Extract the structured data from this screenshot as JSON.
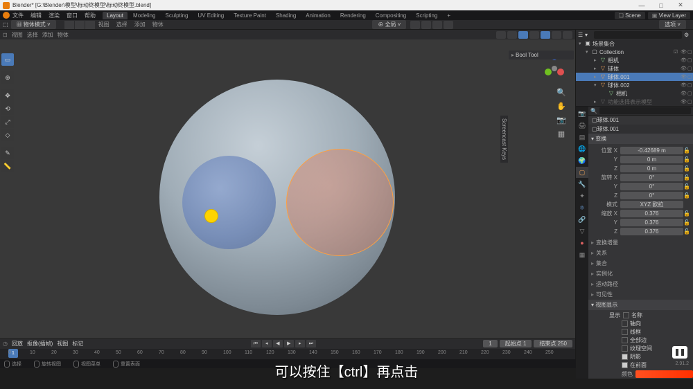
{
  "titlebar": {
    "title": "Blender* [G:\\Blender\\模型\\标动终模型\\标动终模型.blend]"
  },
  "menubar": {
    "menus": [
      "文件",
      "编辑",
      "渲染",
      "窗口",
      "帮助"
    ],
    "tabs": [
      "Layout",
      "Modeling",
      "Sculpting",
      "UV Editing",
      "Texture Paint",
      "Shading",
      "Animation",
      "Rendering",
      "Compositing",
      "Scripting"
    ],
    "active_tab": "Layout",
    "scene_label": "Scene",
    "viewlayer_label": "View Layer"
  },
  "toolbar2": {
    "mode": "物体模式",
    "submenus": [
      "选择",
      "添加",
      "物体",
      "视图"
    ],
    "global": "全局",
    "right_dropdown": "选项"
  },
  "viewport_header": {
    "items": [
      "视图",
      "选择",
      "添加",
      "物体"
    ]
  },
  "bool_tool": {
    "title": "Bool Tool"
  },
  "screencast_tab": "Screencast Keys",
  "outliner": {
    "scene_collection": "场景集合",
    "collection": "Collection",
    "items": [
      {
        "label": "相机",
        "indent": 2
      },
      {
        "label": "球体",
        "indent": 2
      },
      {
        "label": "球体.001",
        "indent": 2,
        "selected": true
      },
      {
        "label": "球体.002",
        "indent": 2
      },
      {
        "label": "相机",
        "indent": 3
      },
      {
        "label": "功能选择表示模型",
        "indent": 2,
        "muted": true
      }
    ]
  },
  "properties": {
    "breadcrumb1": "球体.001",
    "breadcrumb2": "球体.001",
    "transform_title": "变换",
    "location": {
      "label": "位置 X",
      "x": "-0.42689 m",
      "y": "0 m",
      "z": "0 m"
    },
    "rotation": {
      "label": "旋转 X",
      "x": "0°",
      "y": "0°",
      "z": "0°"
    },
    "mode_label": "模式",
    "mode_value": "XYZ 欧拉",
    "scale": {
      "label": "缩放 X",
      "x": "0.376",
      "y": "0.376",
      "z": "0.376"
    },
    "delta": "变换增量",
    "sections": [
      "关系",
      "集合",
      "实例化",
      "运动路径",
      "可见性"
    ],
    "viewport_display": "视图显示",
    "display_label": "显示",
    "checks": [
      {
        "label": "名称",
        "checked": false
      },
      {
        "label": "轴向",
        "checked": false
      },
      {
        "label": "线框",
        "checked": false
      },
      {
        "label": "全部边",
        "checked": false
      },
      {
        "label": "纹理空间",
        "checked": false
      },
      {
        "label": "阴影",
        "checked": true
      },
      {
        "label": "在前面",
        "checked": true
      }
    ],
    "color_label": "颜色"
  },
  "timeline": {
    "left_items": [
      "回放",
      "抠像(插帧)",
      "视图",
      "标记"
    ],
    "current": "1",
    "start_label": "起始点",
    "start": "1",
    "end_label": "结束点",
    "end": "250",
    "ticks": [
      "0",
      "10",
      "20",
      "30",
      "40",
      "50",
      "60",
      "70",
      "80",
      "90",
      "100",
      "110",
      "120",
      "130",
      "140",
      "150",
      "160",
      "170",
      "180",
      "190",
      "200",
      "210",
      "220",
      "230",
      "240",
      "250"
    ]
  },
  "statusbar": {
    "items": [
      "选择",
      "旋转视图",
      "视图菜单",
      "重置表面"
    ],
    "version": "2.91.2"
  },
  "subtitle": "可以按住【ctrl】再点击"
}
